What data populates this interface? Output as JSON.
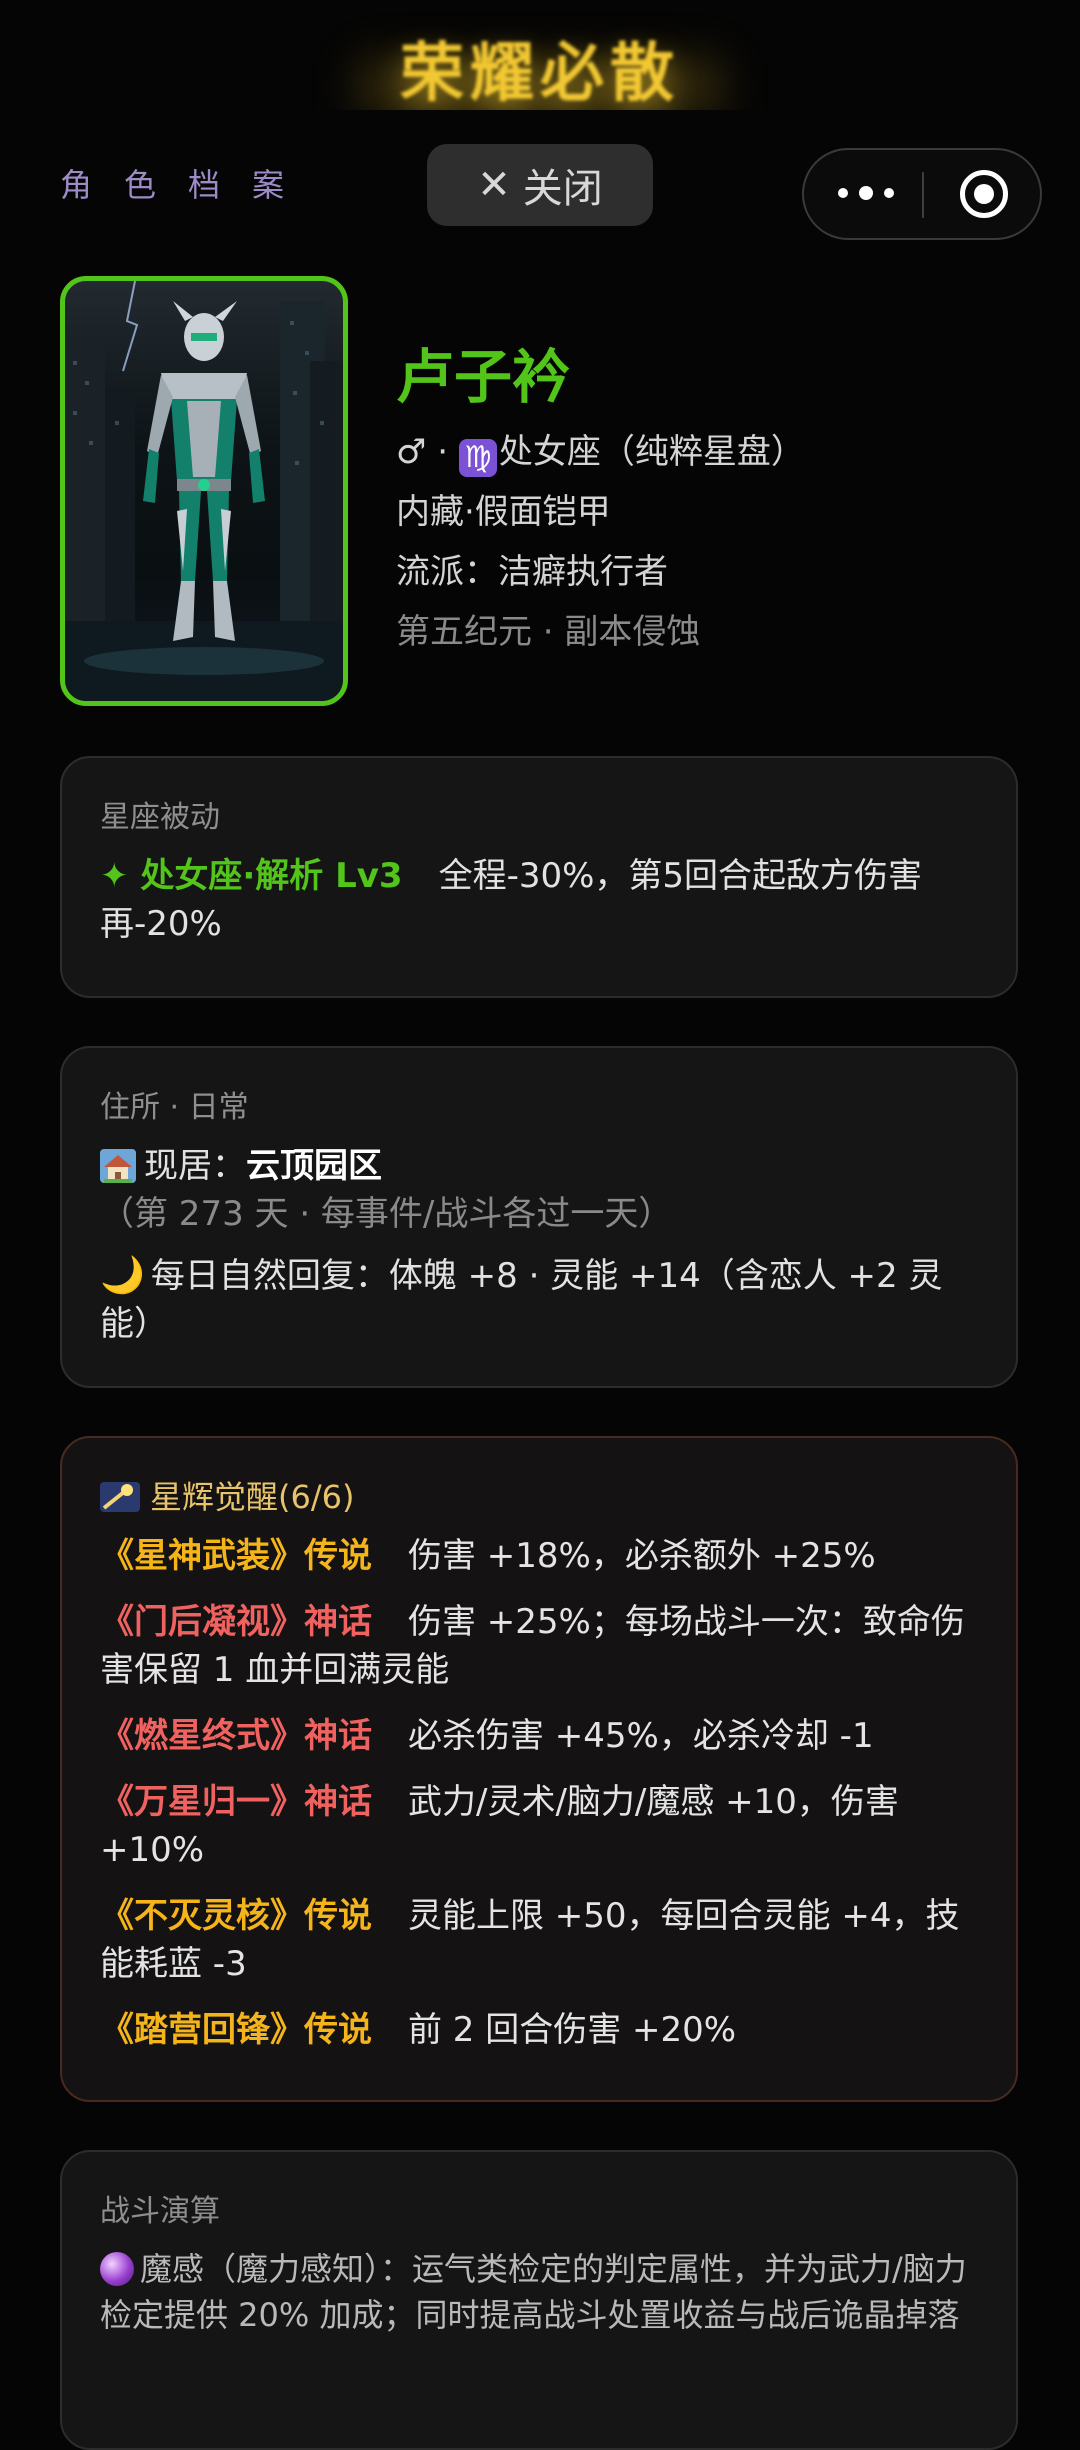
{
  "header": {
    "top_title": "荣耀必散",
    "page_title": "角色档案",
    "close_label": "关闭"
  },
  "profile": {
    "name": "卢子衿",
    "gender_symbol": "♂",
    "zodiac_symbol": "♍",
    "zodiac_text": "处女座（纯粹星盘）",
    "line_hidden": "内藏·假面铠甲",
    "line_school": "流派：洁癖执行者",
    "line_era": "第五纪元 · 副本侵蚀",
    "avatar_icon": "armored-hero-portrait",
    "colors": {
      "accent": "#52c41a",
      "gold": "#f4b41a",
      "red": "#f0625f"
    }
  },
  "passive": {
    "title": "星座被动",
    "skill_name": "✦ 处女座·解析 Lv3",
    "skill_desc": "全程-30%，第5回合起敌方伤害再-20%"
  },
  "residence": {
    "title": "住所 · 日常",
    "current_label": "现居：",
    "current_place": "云顶园区",
    "current_note": "（第 273 天 · 每事件/战斗各过一天）",
    "recovery": "每日自然回复：体魄 +8 · 灵能 +14（含恋人 +2 灵能）"
  },
  "awakening": {
    "title": "星辉觉醒(6/6)",
    "items": [
      {
        "name": "《星神武装》传说",
        "rarity": "gold",
        "desc": "伤害 +18%，必杀额外 +25%"
      },
      {
        "name": "《门后凝视》神话",
        "rarity": "red",
        "desc": "伤害 +25%；每场战斗一次：致命伤害保留 1 血并回满灵能"
      },
      {
        "name": "《燃星终式》神话",
        "rarity": "red",
        "desc": "必杀伤害 +45%，必杀冷却 -1"
      },
      {
        "name": "《万星归一》神话",
        "rarity": "red",
        "desc": "武力/灵术/脑力/魔感 +10，伤害 +10%"
      },
      {
        "name": "《不灭灵核》传说",
        "rarity": "gold",
        "desc": "灵能上限 +50，每回合灵能 +4，技能耗蓝 -3"
      },
      {
        "name": "《踏营回锋》传说",
        "rarity": "gold",
        "desc": "前 2 回合伤害 +20%"
      }
    ]
  },
  "battle": {
    "title": "战斗演算",
    "text": "魔感（魔力感知）：运气类检定的判定属性，并为武力/脑力检定提供 20% 加成；同时提高战斗处置收益与战后诡晶掉落"
  }
}
